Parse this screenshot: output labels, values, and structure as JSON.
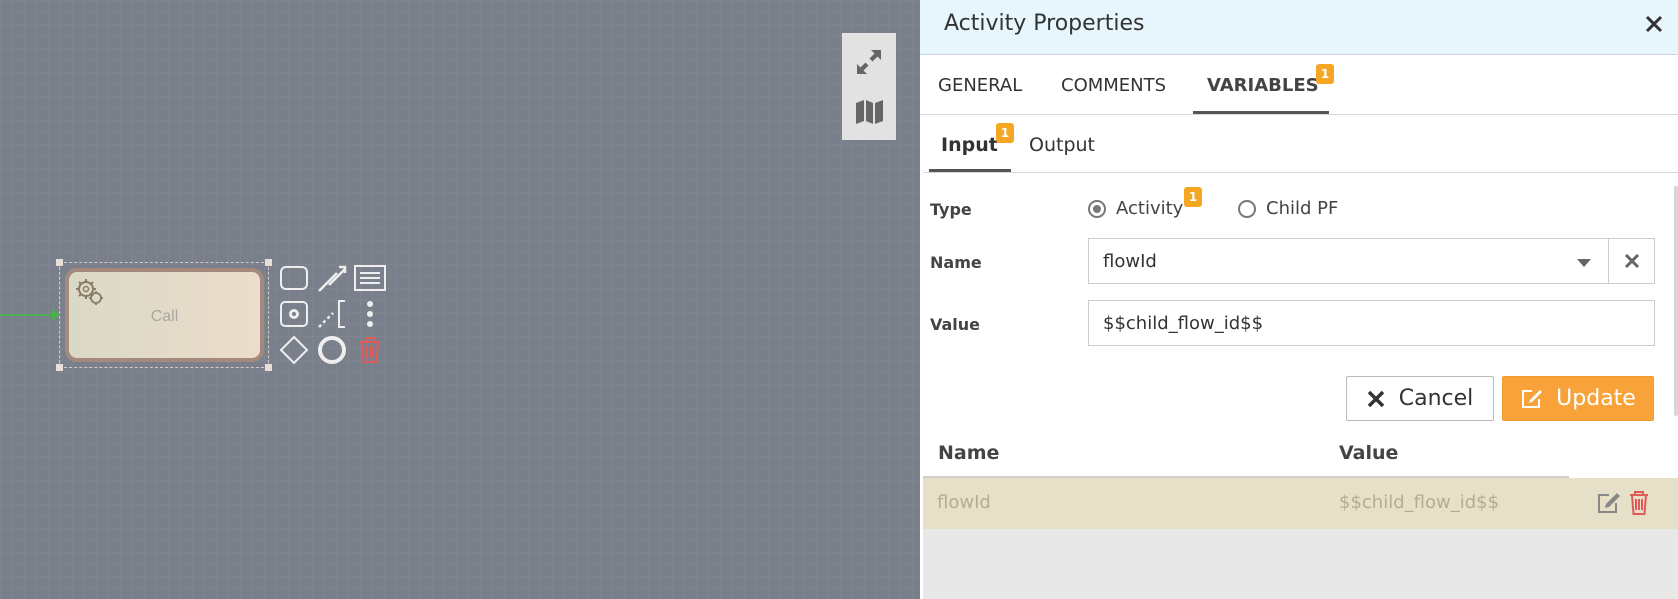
{
  "colors": {
    "accent": "#f7a33a",
    "badge": "#f5a623",
    "header_bg": "#e7f5fc",
    "canvas_bg": "#7a808b",
    "row_bg": "#e6e0c8",
    "delete_red": "#e05a5a"
  },
  "canvas": {
    "task_label": "Call",
    "tools": [
      "expand-icon",
      "map-icon"
    ],
    "palette": [
      "rounded-rect-icon",
      "magic-wand-icon",
      "list-icon",
      "gear-box-icon",
      "dotted-connection-icon",
      "more-vertical-icon",
      "diamond-icon",
      "circle-icon",
      "trash-icon"
    ]
  },
  "panel": {
    "title": "Activity Properties",
    "tabs": [
      {
        "label": "GENERAL"
      },
      {
        "label": "COMMENTS"
      },
      {
        "label": "VARIABLES",
        "badge": "1"
      }
    ],
    "subtabs": [
      {
        "label": "Input",
        "badge": "1"
      },
      {
        "label": "Output"
      }
    ],
    "form": {
      "type_label": "Type",
      "type_options": [
        {
          "label": "Activity",
          "badge": "1",
          "checked": true
        },
        {
          "label": "Child PF",
          "checked": false
        }
      ],
      "name_label": "Name",
      "name_value": "flowId",
      "value_label": "Value",
      "value_value": "$$child_flow_id$$"
    },
    "buttons": {
      "cancel": "Cancel",
      "update": "Update"
    },
    "grid": {
      "columns": [
        "Name",
        "Value"
      ],
      "rows": [
        {
          "name": "flowId",
          "value": "$$child_flow_id$$"
        }
      ]
    }
  }
}
